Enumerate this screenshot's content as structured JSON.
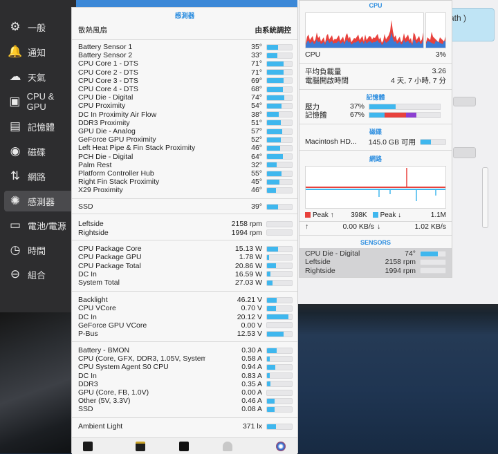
{
  "sidebar": {
    "items": [
      {
        "label": "一般",
        "icon": "gear-icon"
      },
      {
        "label": "通知",
        "icon": "bell-icon"
      },
      {
        "label": "天氣",
        "icon": "cloud-icon"
      },
      {
        "label": "CPU & GPU",
        "icon": "chip-icon"
      },
      {
        "label": "記憶體",
        "icon": "memory-icon"
      },
      {
        "label": "磁碟",
        "icon": "disk-icon"
      },
      {
        "label": "網路",
        "icon": "network-icon"
      },
      {
        "label": "感測器",
        "icon": "sensor-icon"
      },
      {
        "label": "電池/電源",
        "icon": "battery-icon"
      },
      {
        "label": "時間",
        "icon": "clock-icon"
      },
      {
        "label": "組合",
        "icon": "combine-icon"
      }
    ],
    "active_index": 7
  },
  "background_window": {
    "top_text": "ath )"
  },
  "sensors_panel": {
    "title": "感測器",
    "fan_label": "散熱風扇",
    "fan_mode": "由系統調控",
    "temperatures": [
      {
        "label": "Battery Sensor 1",
        "value": "35°",
        "level": 0.45
      },
      {
        "label": "Battery Sensor 2",
        "value": "33°",
        "level": 0.42
      },
      {
        "label": "CPU Core 1 - DTS",
        "value": "71°",
        "level": 0.68
      },
      {
        "label": "CPU Core 2 - DTS",
        "value": "71°",
        "level": 0.68
      },
      {
        "label": "CPU Core 3 - DTS",
        "value": "69°",
        "level": 0.66
      },
      {
        "label": "CPU Core 4 - DTS",
        "value": "68°",
        "level": 0.65
      },
      {
        "label": "CPU Die - Digital",
        "value": "74°",
        "level": 0.7
      },
      {
        "label": "CPU Proximity",
        "value": "54°",
        "level": 0.58
      },
      {
        "label": "DC In Proximity Air Flow",
        "value": "38°",
        "level": 0.48
      },
      {
        "label": "DDR3 Proximity",
        "value": "51°",
        "level": 0.55
      },
      {
        "label": "GPU Die - Analog",
        "value": "57°",
        "level": 0.6
      },
      {
        "label": "GeForce GPU Proximity",
        "value": "52°",
        "level": 0.56
      },
      {
        "label": "Left Heat Pipe & Fin Stack Proximity",
        "value": "46°",
        "level": 0.52
      },
      {
        "label": "PCH Die - Digital",
        "value": "64°",
        "level": 0.63
      },
      {
        "label": "Palm Rest",
        "value": "32°",
        "level": 0.4
      },
      {
        "label": "Platform Controller Hub",
        "value": "55°",
        "level": 0.59
      },
      {
        "label": "Right Fin Stack Proximity",
        "value": "45°",
        "level": 0.5
      },
      {
        "label": "X29 Proximity",
        "value": "46°",
        "level": 0.35
      }
    ],
    "ssd": {
      "label": "SSD",
      "value": "39°",
      "level": 0.45
    },
    "fans": [
      {
        "label": "Leftside",
        "value": "2158 rpm",
        "level": 0.0
      },
      {
        "label": "Rightside",
        "value": "1994 rpm",
        "level": 0.0
      }
    ],
    "power": [
      {
        "label": "CPU Package Core",
        "value": "15.13 W",
        "level": 0.45
      },
      {
        "label": "CPU Package GPU",
        "value": "1.78 W",
        "level": 0.08
      },
      {
        "label": "CPU Package Total",
        "value": "20.86 W",
        "level": 0.35
      },
      {
        "label": "DC In",
        "value": "16.59 W",
        "level": 0.15
      },
      {
        "label": "System Total",
        "value": "27.03 W",
        "level": 0.22
      }
    ],
    "voltage": [
      {
        "label": "Backlight",
        "value": "46.21 V",
        "level": 0.38
      },
      {
        "label": "CPU VCore",
        "value": "0.70 V",
        "level": 0.35
      },
      {
        "label": "DC In",
        "value": "20.12 V",
        "level": 0.85
      },
      {
        "label": "GeForce GPU VCore",
        "value": "0.00 V",
        "level": 0.0
      },
      {
        "label": "P-Bus",
        "value": "12.53 V",
        "level": 0.68
      }
    ],
    "current": [
      {
        "label": "Battery - BMON",
        "value": "0.30 A",
        "level": 0.38
      },
      {
        "label": "CPU (Core, GFX, DDR3, 1.05V, System Agent)",
        "value": "0.58 A",
        "level": 0.1
      },
      {
        "label": "CPU System Agent S0 CPU",
        "value": "0.94 A",
        "level": 0.32
      },
      {
        "label": "DC In",
        "value": "0.83 A",
        "level": 0.12
      },
      {
        "label": "DDR3",
        "value": "0.35 A",
        "level": 0.14
      },
      {
        "label": "GPU (Core, FB, 1.0V)",
        "value": "0.00 A",
        "level": 0.0
      },
      {
        "label": "Other (5V, 3.3V)",
        "value": "0.46 A",
        "level": 0.3
      },
      {
        "label": "SSD",
        "value": "0.08 A",
        "level": 0.3
      }
    ],
    "light": {
      "label": "Ambient Light",
      "value": "371 lx",
      "level": 0.35
    }
  },
  "cpu_panel": {
    "cpu_title": "CPU",
    "cpu_label": "CPU",
    "cpu_value": "3%",
    "load_label": "平均負載量",
    "load_value": "3.26",
    "uptime_label": "電腦開啟時間",
    "uptime_value": "4 天, 7 小時, 7 分",
    "memory_title": "記憶體",
    "pressure_label": "壓力",
    "pressure_value": "37%",
    "pressure_level": 0.37,
    "memory_label": "記憶體",
    "memory_value": "67%",
    "disk_title": "磁碟",
    "disk_label": "Macintosh HD...",
    "disk_value": "145.0 GB 可用",
    "disk_level": 0.42,
    "network_title": "網路",
    "peak_up_label": "Peak ↑",
    "peak_up_value": "398K",
    "peak_down_label": "Peak ↓",
    "peak_down_value": "1.1M",
    "up_arrow": "↑",
    "up_value": "0.00 KB/s",
    "down_arrow": "↓",
    "down_value": "1.02 KB/s",
    "sensors_title": "SENSORS",
    "sensors": [
      {
        "label": "CPU Die - Digital",
        "value": "74°",
        "level": 0.7
      },
      {
        "label": "Leftside",
        "value": "2158 rpm",
        "level": 0.0
      },
      {
        "label": "Rightside",
        "value": "1994 rpm",
        "level": 0.0
      }
    ],
    "colors": {
      "accent": "#2f8fe0",
      "bar": "#3fb7ee",
      "red": "#e8413c",
      "purple": "#8c3fd1"
    }
  }
}
